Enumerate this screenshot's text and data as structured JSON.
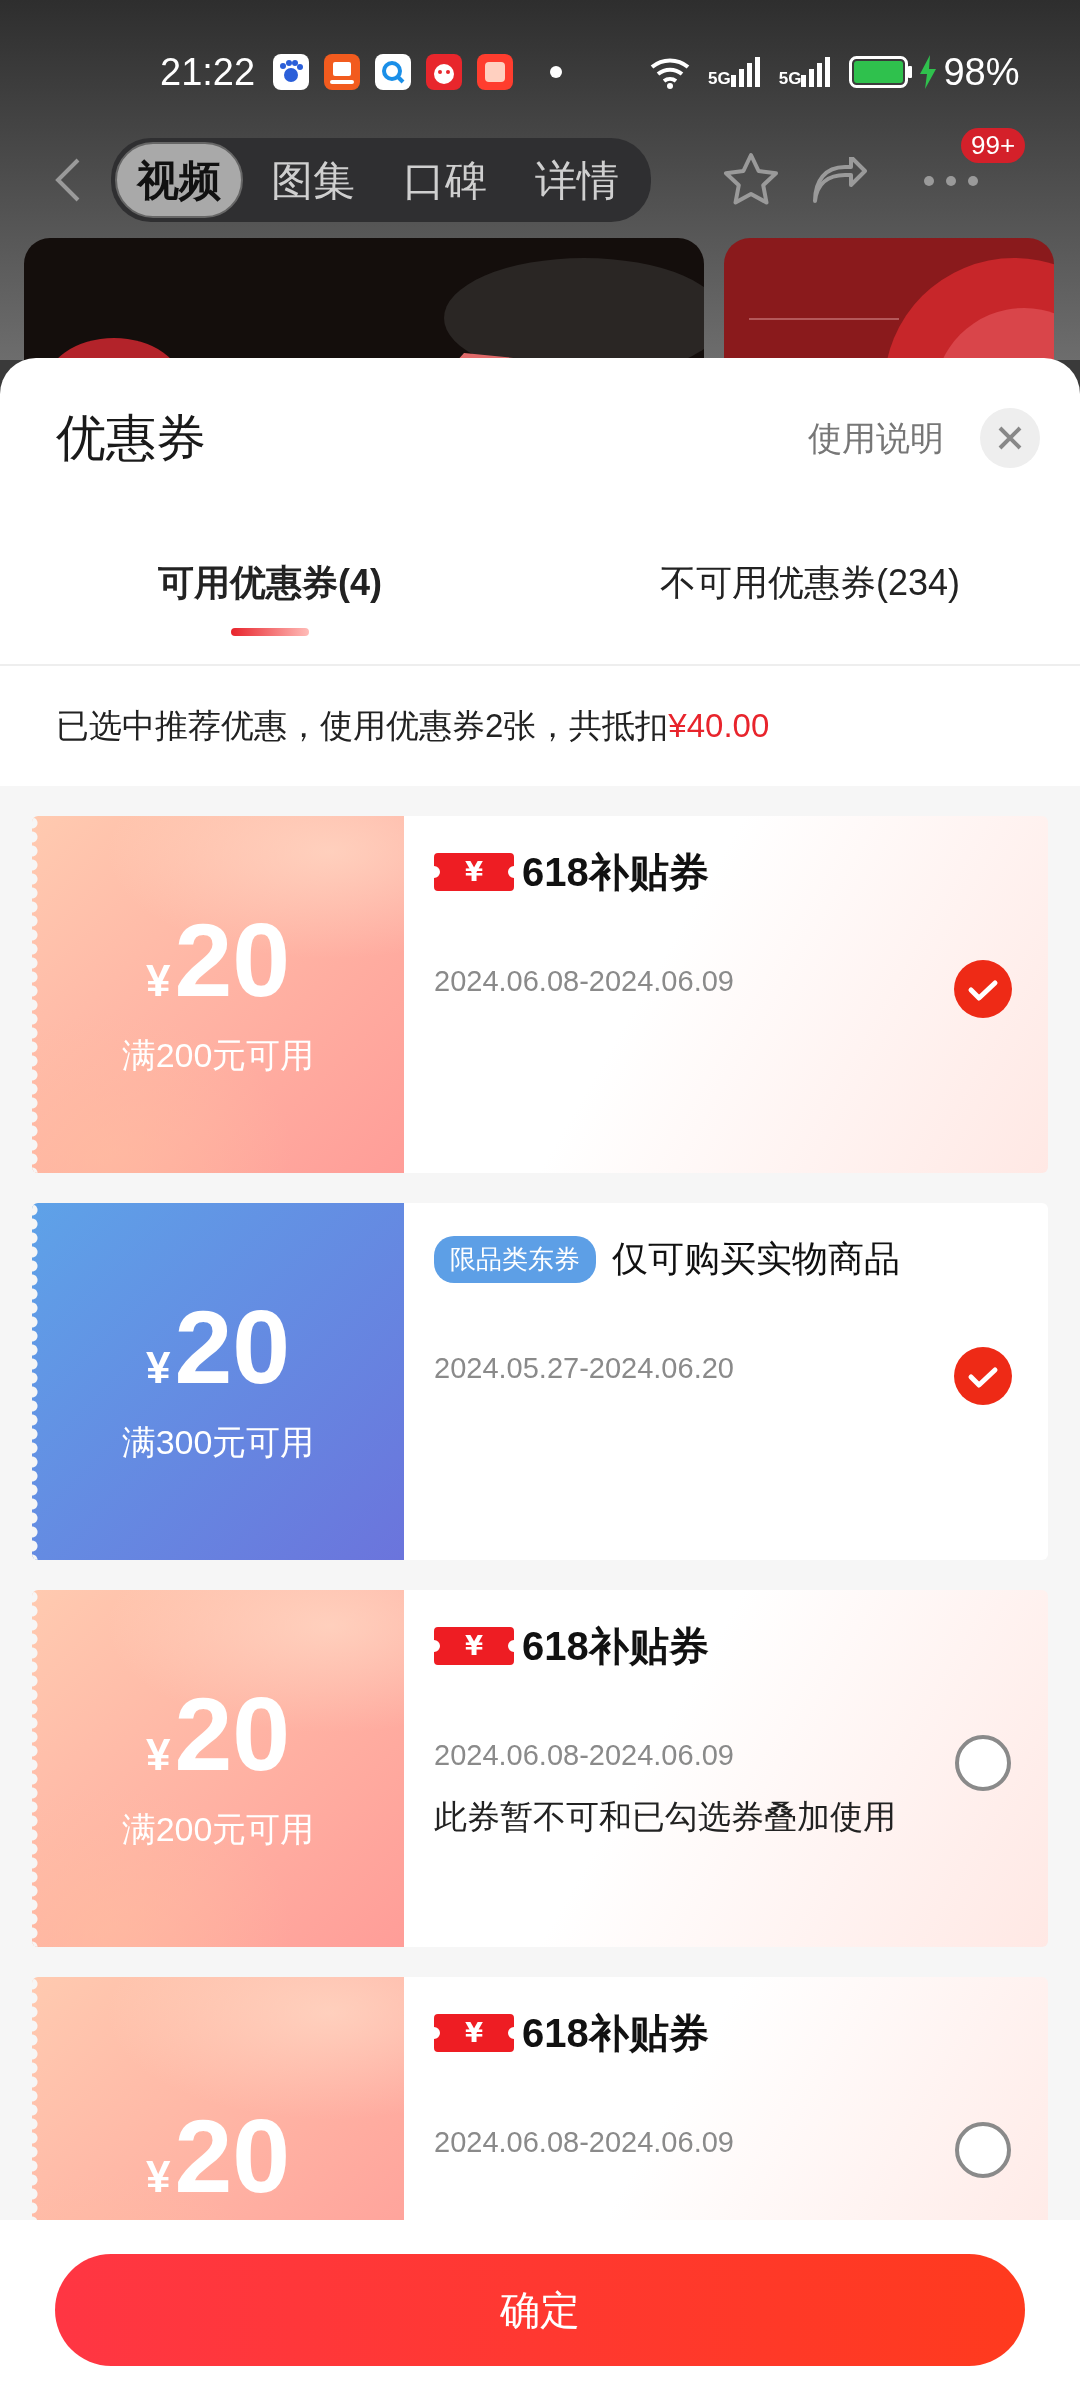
{
  "status_bar": {
    "time": "21:22",
    "networks": [
      "5G",
      "5G"
    ],
    "battery": "98%"
  },
  "nav": {
    "tabs": [
      {
        "label": "视频",
        "selected": true
      },
      {
        "label": "图集",
        "selected": false
      },
      {
        "label": "口碑",
        "selected": false
      },
      {
        "label": "详情",
        "selected": false
      }
    ],
    "badge": "99+"
  },
  "sheet": {
    "title": "优惠券",
    "help_link": "使用说明",
    "tabs": [
      {
        "label": "可用优惠券(4)",
        "selected": true
      },
      {
        "label": "不可用优惠券(234)",
        "selected": false
      }
    ],
    "summary": {
      "text": "已选中推荐优惠，使用优惠券2张，共抵扣",
      "amount": "¥40.00"
    },
    "coupons": [
      {
        "kind": "subsidy",
        "currency": "¥",
        "amount": "20",
        "condition": "满200元可用",
        "tag": "¥",
        "title": "618补贴券",
        "dates": "2024.06.08-2024.06.09",
        "selected": true
      },
      {
        "kind": "category",
        "currency": "¥",
        "amount": "20",
        "condition": "满300元可用",
        "tag": "限品类东券",
        "title": "仅可购买实物商品",
        "dates": "2024.05.27-2024.06.20",
        "selected": true
      },
      {
        "kind": "subsidy",
        "currency": "¥",
        "amount": "20",
        "condition": "满200元可用",
        "tag": "¥",
        "title": "618补贴券",
        "dates": "2024.06.08-2024.06.09",
        "note": "此券暂不可和已勾选券叠加使用",
        "selected": false
      },
      {
        "kind": "subsidy",
        "currency": "¥",
        "amount": "20",
        "tag": "¥",
        "title": "618补贴券",
        "dates": "2024.06.08-2024.06.09",
        "selected": false
      }
    ]
  },
  "confirm_button": "确定"
}
